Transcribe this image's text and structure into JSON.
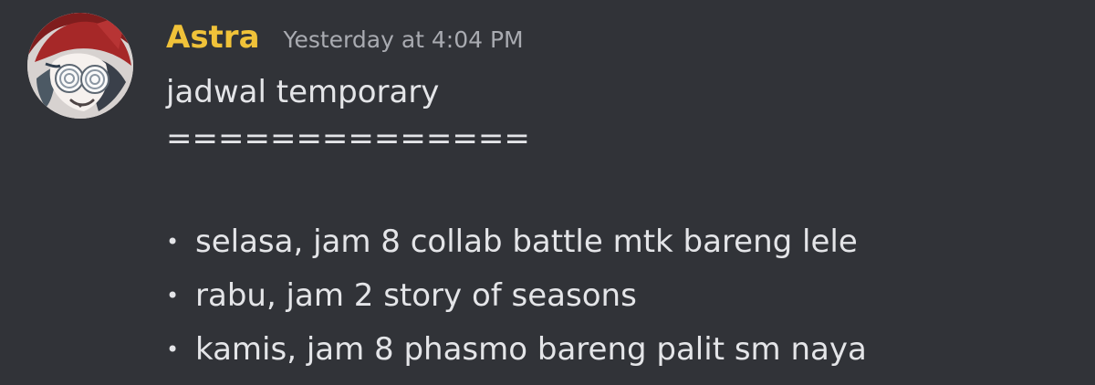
{
  "message": {
    "author": "Astra",
    "timestamp": "Yesterday at 4:04 PM",
    "lines": [
      "jadwal temporary",
      "=============="
    ],
    "bullets": [
      "selasa, jam 8 collab battle mtk bareng lele",
      "rabu, jam 2 story of seasons",
      "kamis, jam 8 phasmo bareng palit sm naya"
    ]
  },
  "colors": {
    "background": "#313338",
    "username": "#f0c239",
    "timestamp": "#a9abb1",
    "text": "#e4e5e8"
  },
  "icons": {
    "bullet": "•",
    "avatar": "avatar-image"
  }
}
